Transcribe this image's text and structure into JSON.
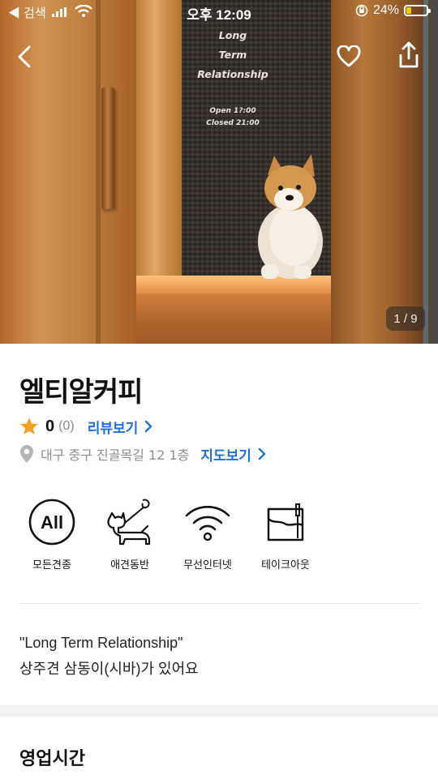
{
  "status_bar": {
    "back_label": "◀ 검색",
    "time": "오후 12:09",
    "battery": "24%"
  },
  "hero": {
    "sign_lines": [
      "Long",
      "Term",
      "Relationship"
    ],
    "sign_hours": [
      "Open 1?:00",
      "Closed 21:00"
    ],
    "image_counter": "1 / 9"
  },
  "place": {
    "name": "엘티알커피",
    "rating": "0",
    "review_count": "(0)",
    "review_link": "리뷰보기",
    "address": "대구 중구 진골목길 12 1층",
    "map_link": "지도보기"
  },
  "amenities": [
    {
      "icon": "all-icon",
      "label": "모든견종",
      "badge": "All"
    },
    {
      "icon": "dog-leash-icon",
      "label": "애견동반"
    },
    {
      "icon": "wifi-icon",
      "label": "무선인터넷"
    },
    {
      "icon": "takeout-bag-icon",
      "label": "테이크아웃"
    }
  ],
  "description": {
    "line1": "\"Long Term Relationship\"",
    "line2": "상주견 삼동이(시바)가 있어요"
  },
  "sections": {
    "hours_title": "영업시간"
  },
  "colors": {
    "accent": "#1f6fe0",
    "star": "#f39c1f"
  }
}
